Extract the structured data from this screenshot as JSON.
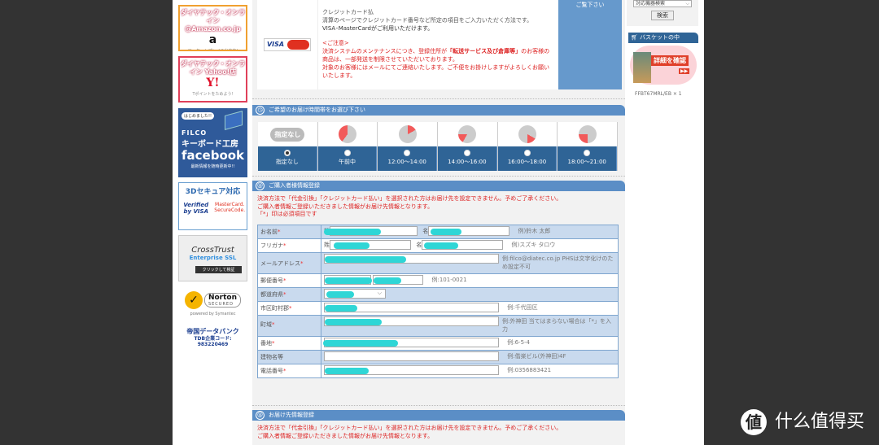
{
  "left_banners": {
    "amazon": {
      "title": "ダイヤテック・オンライン @Amazon.co.jp",
      "logo": "a",
      "sub": "マーケットプレイス出店中!"
    },
    "yahoo": {
      "title": "ダイヤテック・オンライン Yahoo!店",
      "logo": "Y!",
      "sub": "Tポイントをためよう!"
    },
    "facebook": {
      "bubble": "はじめました!!",
      "brand": "FILCO",
      "line1": "キーボード工房",
      "line2": "facebook",
      "sub": "最新情報を随時更新中!!"
    },
    "secure3d": {
      "title": "3Dセキュア対応",
      "visa": "Verified by VISA",
      "mc": "MasterCard. SecureCode."
    },
    "crosstrust": {
      "name": "CrossTrust",
      "sub": "Enterprise SSL",
      "button": "クリックして検証"
    },
    "norton": {
      "name": "Norton",
      "secured": "SECURED",
      "powered": "powered by Symantec"
    },
    "tdb": {
      "name": "帝国データバンク",
      "code_label": "TDB企業コード:",
      "code": "983220469"
    }
  },
  "payment": {
    "card_logo": "VISA MasterCard",
    "title": "クレジットカード払",
    "desc1": "清算のページでクレジットカード番号など所定の項目をご入力いただく方法です。",
    "desc2": "VISA･MasterCardがご利用いただけます。",
    "notice_head": "<ご注意>",
    "notice_1": "決済システムのメンテナンスにつき、登録住所が",
    "notice_bold": "「転送サービス及び倉庫等」",
    "notice_2": "のお客様の商品は、一部発送を制限させていただいております。",
    "notice_3": "対象のお客様にはメールにてご連絡いたします。ご不便をお掛けしますがよろしくお願いいたします。",
    "side_label": "ご覧下さい"
  },
  "delivery_time": {
    "header": "ご希望のお届け時間帯をお選び下さい",
    "options": [
      {
        "label": "指定なし",
        "selected": true,
        "icon": "指定なし"
      },
      {
        "label": "午前中",
        "selected": false
      },
      {
        "label": "12:00～14:00",
        "selected": false
      },
      {
        "label": "14:00～16:00",
        "selected": false
      },
      {
        "label": "16:00～18:00",
        "selected": false
      },
      {
        "label": "18:00～21:00",
        "selected": false
      }
    ]
  },
  "buyer": {
    "header": "ご購入者様情報登録",
    "notice1": "決済方法で「代金引換」「クレジットカード払い」を選択された方はお届け先を設定できません。予めご了承ください。",
    "notice2": "ご購入者情報ご登録いただきました情報がお届け先情報となります。",
    "notice3": "「*」印は必須項目です",
    "rows": [
      {
        "label": "お名前",
        "req": "*",
        "pre1": "姓",
        "pre2": "名",
        "hint": "例)鈴木 太郎"
      },
      {
        "label": "フリガナ",
        "req": "*",
        "pre1": "姓",
        "pre2": "名",
        "hint": "例)スズキ タロウ"
      },
      {
        "label": "メールアドレス",
        "req": "*",
        "hint": "例:filco@diatec.co.jp PHSは文字化けのため設定不可"
      },
      {
        "label": "郵便番号",
        "req": "*",
        "hint": "例:101-0021"
      },
      {
        "label": "都道府県",
        "req": "*"
      },
      {
        "label": "市区町村郡",
        "req": "*",
        "hint": "例:千代田区"
      },
      {
        "label": "町域",
        "req": "*",
        "hint": "例:外神田 当てはまらない場合は「*」を入力"
      },
      {
        "label": "番地",
        "req": "*",
        "hint": "例:6-5-4"
      },
      {
        "label": "建物名等",
        "req": "",
        "hint": "例:偕楽ビル(外神田)4F"
      },
      {
        "label": "電話番号",
        "req": "*",
        "hint": "例:0356883421"
      }
    ]
  },
  "shipping": {
    "header": "お届け先情報登録",
    "notice1": "決済方法で「代金引換」「クレジットカード払い」を選択された方はお届け先を設定できません。予めご了承ください。",
    "notice2": "ご購入者情報ご登録いただきました情報がお届け先情報となります。"
  },
  "right": {
    "search_select": "対応機器検索",
    "search_button": "検索",
    "basket_header": "バスケットの中",
    "basket_banner": "詳細を確認",
    "basket_item": "FFBT67MRL/EB × 1"
  },
  "watermark": {
    "icon": "値",
    "text": "什么值得买"
  },
  "colors": {
    "accent": "#5b8ec6",
    "dark_blue": "#2f6496",
    "notice_red": "#d22",
    "highlight": "#2fd6d6"
  }
}
